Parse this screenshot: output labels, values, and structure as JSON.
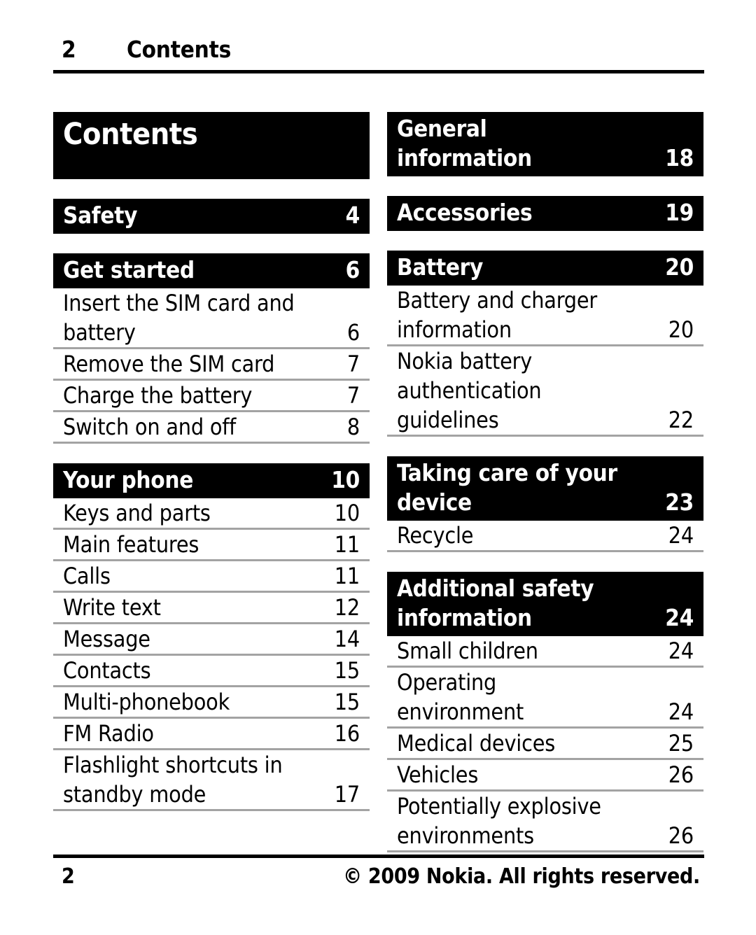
{
  "header": {
    "page_number": "2",
    "title": "Contents"
  },
  "title_block": {
    "text": "Contents"
  },
  "left_column": [
    {
      "kind": "section",
      "name": "safety",
      "lines": [
        {
          "label": "Safety",
          "page": "4"
        }
      ],
      "children": []
    },
    {
      "kind": "section",
      "name": "get-started",
      "lines": [
        {
          "label": "Get started",
          "page": "6"
        }
      ],
      "children": [
        {
          "lines": [
            {
              "label": "Insert the SIM card and",
              "page": ""
            },
            {
              "label": "battery",
              "page": "6"
            }
          ]
        },
        {
          "lines": [
            {
              "label": "Remove the SIM card",
              "page": "7"
            }
          ]
        },
        {
          "lines": [
            {
              "label": "Charge the battery",
              "page": "7"
            }
          ]
        },
        {
          "lines": [
            {
              "label": "Switch on and off",
              "page": "8"
            }
          ]
        }
      ]
    },
    {
      "kind": "section",
      "name": "your-phone",
      "lines": [
        {
          "label": "Your phone",
          "page": "10"
        }
      ],
      "children": [
        {
          "lines": [
            {
              "label": "Keys and parts",
              "page": "10"
            }
          ]
        },
        {
          "lines": [
            {
              "label": "Main features",
              "page": "11"
            }
          ]
        },
        {
          "lines": [
            {
              "label": "Calls",
              "page": "11"
            }
          ]
        },
        {
          "lines": [
            {
              "label": "Write text",
              "page": "12"
            }
          ]
        },
        {
          "lines": [
            {
              "label": "Message",
              "page": "14"
            }
          ]
        },
        {
          "lines": [
            {
              "label": "Contacts",
              "page": "15"
            }
          ]
        },
        {
          "lines": [
            {
              "label": "Multi-phonebook",
              "page": "15"
            }
          ]
        },
        {
          "lines": [
            {
              "label": "FM Radio",
              "page": "16"
            }
          ]
        },
        {
          "lines": [
            {
              "label": "Flashlight shortcuts in",
              "page": ""
            },
            {
              "label": "standby mode",
              "page": "17"
            }
          ]
        }
      ]
    }
  ],
  "right_column": [
    {
      "kind": "section",
      "name": "general-information",
      "lines": [
        {
          "label": "General",
          "page": ""
        },
        {
          "label": "information",
          "page": "18"
        }
      ],
      "children": []
    },
    {
      "kind": "section",
      "name": "accessories",
      "lines": [
        {
          "label": "Accessories",
          "page": "19"
        }
      ],
      "children": []
    },
    {
      "kind": "section",
      "name": "battery",
      "lines": [
        {
          "label": "Battery",
          "page": "20"
        }
      ],
      "children": [
        {
          "lines": [
            {
              "label": "Battery and charger",
              "page": ""
            },
            {
              "label": "information",
              "page": "20"
            }
          ]
        },
        {
          "lines": [
            {
              "label": "Nokia battery",
              "page": ""
            },
            {
              "label": "authentication",
              "page": ""
            },
            {
              "label": "guidelines",
              "page": "22"
            }
          ]
        }
      ]
    },
    {
      "kind": "section",
      "name": "taking-care-of-your-device",
      "lines": [
        {
          "label": "Taking care of your",
          "page": ""
        },
        {
          "label": "device",
          "page": "23"
        }
      ],
      "children": [
        {
          "lines": [
            {
              "label": "Recycle",
              "page": "24"
            }
          ]
        }
      ]
    },
    {
      "kind": "section",
      "name": "additional-safety-information",
      "lines": [
        {
          "label": "Additional safety",
          "page": ""
        },
        {
          "label": "information",
          "page": "24"
        }
      ],
      "children": [
        {
          "lines": [
            {
              "label": "Small children",
              "page": "24"
            }
          ]
        },
        {
          "lines": [
            {
              "label": "Operating",
              "page": ""
            },
            {
              "label": "environment",
              "page": "24"
            }
          ]
        },
        {
          "lines": [
            {
              "label": "Medical devices",
              "page": "25"
            }
          ]
        },
        {
          "lines": [
            {
              "label": "Vehicles",
              "page": "26"
            }
          ]
        },
        {
          "lines": [
            {
              "label": "Potentially explosive",
              "page": ""
            },
            {
              "label": "environments",
              "page": "26"
            }
          ]
        }
      ]
    }
  ],
  "footer": {
    "page_number": "2",
    "copyright": "© 2009 Nokia. All rights reserved."
  },
  "colors": {
    "bar_background": "#000000",
    "bar_text": "#ffffff",
    "body_text": "#000000",
    "rule": "#000000",
    "sub_underline": "#a3a3a3",
    "page_background": "#ffffff"
  }
}
